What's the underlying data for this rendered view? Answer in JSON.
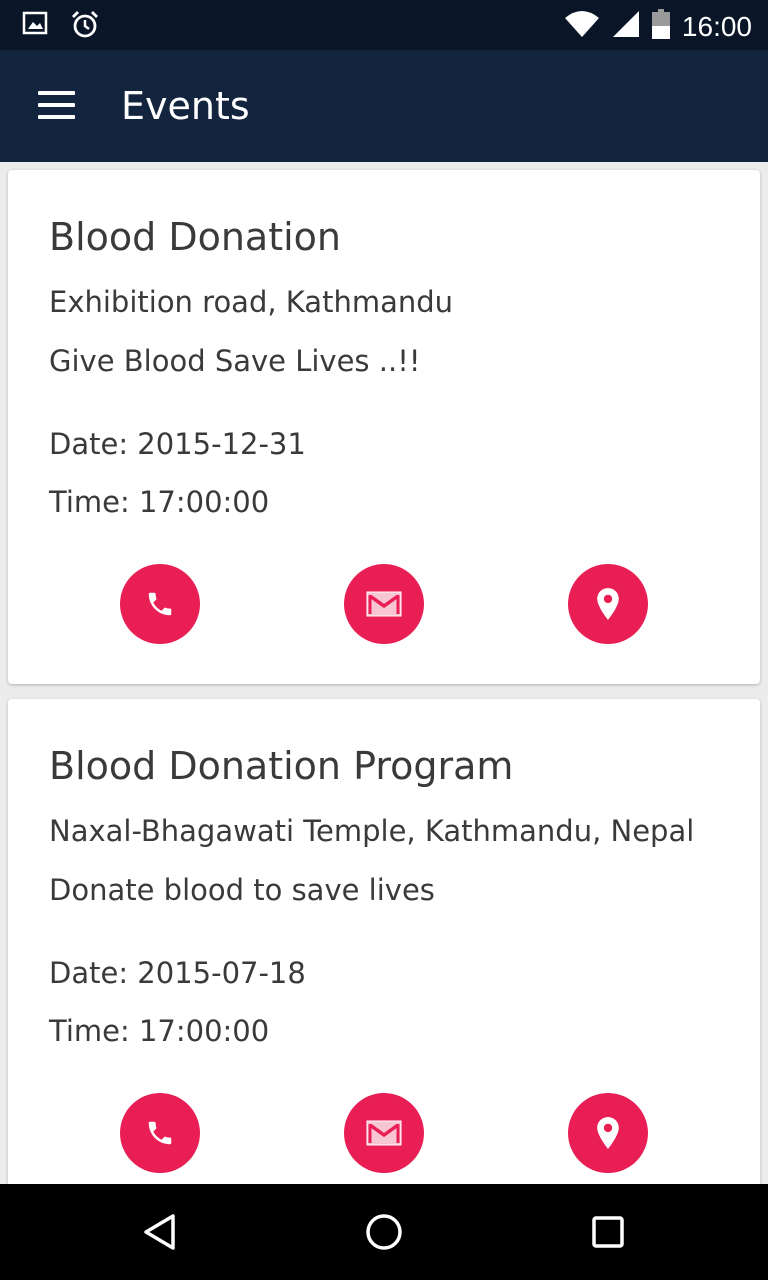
{
  "status_bar": {
    "time": "16:00",
    "icons": [
      "image-icon",
      "alarm-icon",
      "wifi-icon",
      "signal-icon",
      "battery-icon"
    ]
  },
  "app_bar": {
    "title": "Events",
    "menu_icon": "menu-icon"
  },
  "colors": {
    "app_bar": "#13243f",
    "status_bar": "#0a1628",
    "accent": "#e91e55"
  },
  "events": [
    {
      "title": "Blood Donation",
      "location": "Exhibition road, Kathmandu",
      "description": "Give Blood Save Lives ..!!",
      "date": "Date: 2015-12-31",
      "time": "Time: 17:00:00",
      "actions": [
        "phone-icon",
        "mail-icon",
        "location-icon"
      ]
    },
    {
      "title": "Blood Donation Program",
      "location": "Naxal-Bhagawati Temple, Kathmandu, Nepal",
      "description": "Donate blood to save lives",
      "date": "Date: 2015-07-18",
      "time": "Time: 17:00:00",
      "actions": [
        "phone-icon",
        "mail-icon",
        "location-icon"
      ]
    }
  ],
  "nav_bar": {
    "buttons": [
      "back-icon",
      "home-icon",
      "recents-icon"
    ]
  }
}
